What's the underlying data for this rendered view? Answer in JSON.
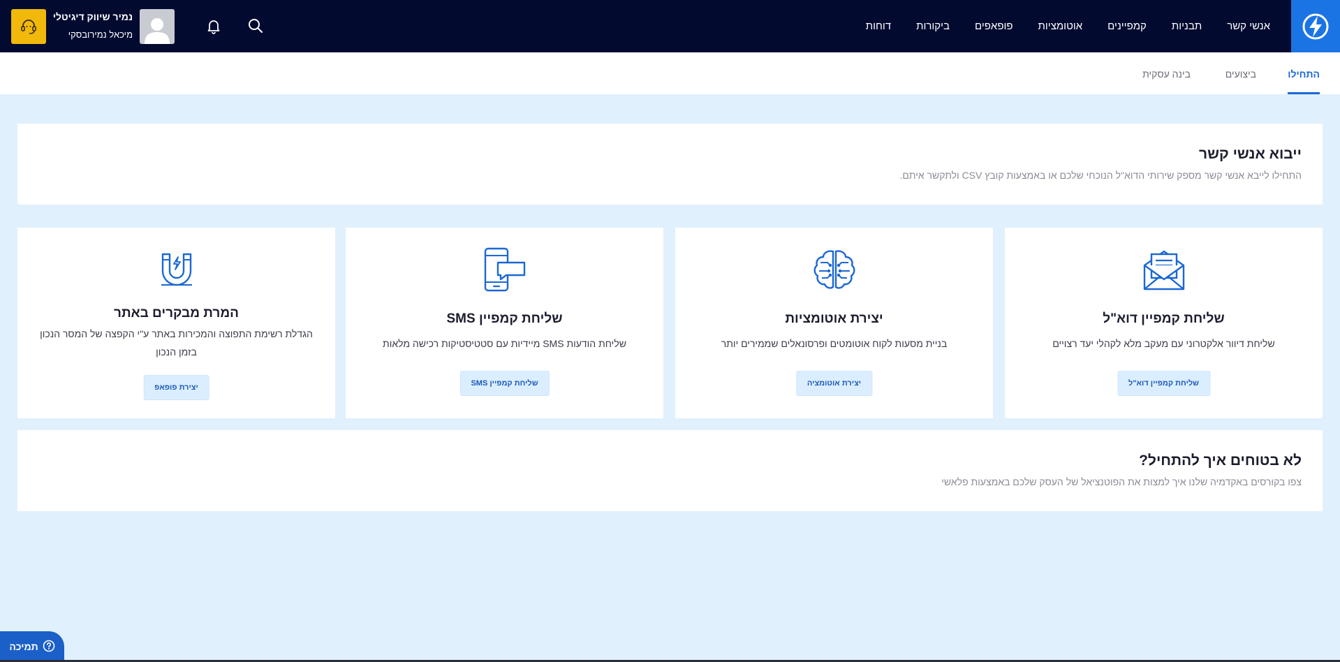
{
  "topbar": {
    "nav_items": [
      "אנשי קשר",
      "תבניות",
      "קמפיינים",
      "אוטומציות",
      "פופאפים",
      "ביקורות",
      "דוחות"
    ],
    "account_name": "נמיר שיווק דיגיטלי",
    "account_user": "מיכאל נמירובסקי",
    "icons": {
      "logo": "lightning-logo-icon",
      "search": "search-icon",
      "notifications": "bell-icon",
      "avatar": "user-avatar-icon",
      "support": "headset-icon"
    },
    "colors": {
      "bar": "#020a30",
      "logo_bg": "#1b74e4",
      "support_bg": "#f0b90b"
    }
  },
  "subtabs": [
    {
      "label": "התחילו",
      "active": true
    },
    {
      "label": "ביצועים",
      "active": false
    },
    {
      "label": "בינה עסקית",
      "active": false
    }
  ],
  "import_panel": {
    "title": "ייבוא אנשי קשר",
    "subtitle": "התחילו לייבא אנשי קשר מספק שירותי הדוא\"ל הנוכחי שלכם או באמצעות קובץ CSV ולתקשר איתם."
  },
  "cards": [
    {
      "title": "שליחת קמפיין דוא\"ל",
      "description": "שליחת דיוור אלקטרוני עם מעקב מלא לקהלי יעד רצויים",
      "button": "שליחת קמפיין דוא\"ל",
      "icon": "envelope-icon"
    },
    {
      "title": "יצירת אוטומציות",
      "description": "בניית מסעות לקוח אוטומטים ופרסונאלים שממירים יותר",
      "button": "יצירת אוטומציה",
      "icon": "brain-icon"
    },
    {
      "title": "שליחת קמפיין SMS",
      "description": "שליחת הודעות SMS מיידיות עם סטטיסטיקות רכישה מלאות",
      "button": "שליחת קמפיין SMS",
      "icon": "mobile-message-icon"
    },
    {
      "title": "המרת מבקרים באתר",
      "description": "הגדלת רשימת התפוצה והמכירות באתר ע\"י הקפצה של המסר הנכון בזמן הנכון",
      "button": "יצירת פופאפ",
      "icon": "magnet-icon"
    }
  ],
  "help_panel": {
    "title": "לא בטוחים איך להתחיל?",
    "subtitle": "צפו בקורסים באקדמיה שלנו איך למצות את הפוטנציאל של העסק שלכם באמצעות פלאשי"
  },
  "support_tab": {
    "label": "תמיכה",
    "icon": "question-circle-icon"
  },
  "accent_color": "#1b68d4"
}
